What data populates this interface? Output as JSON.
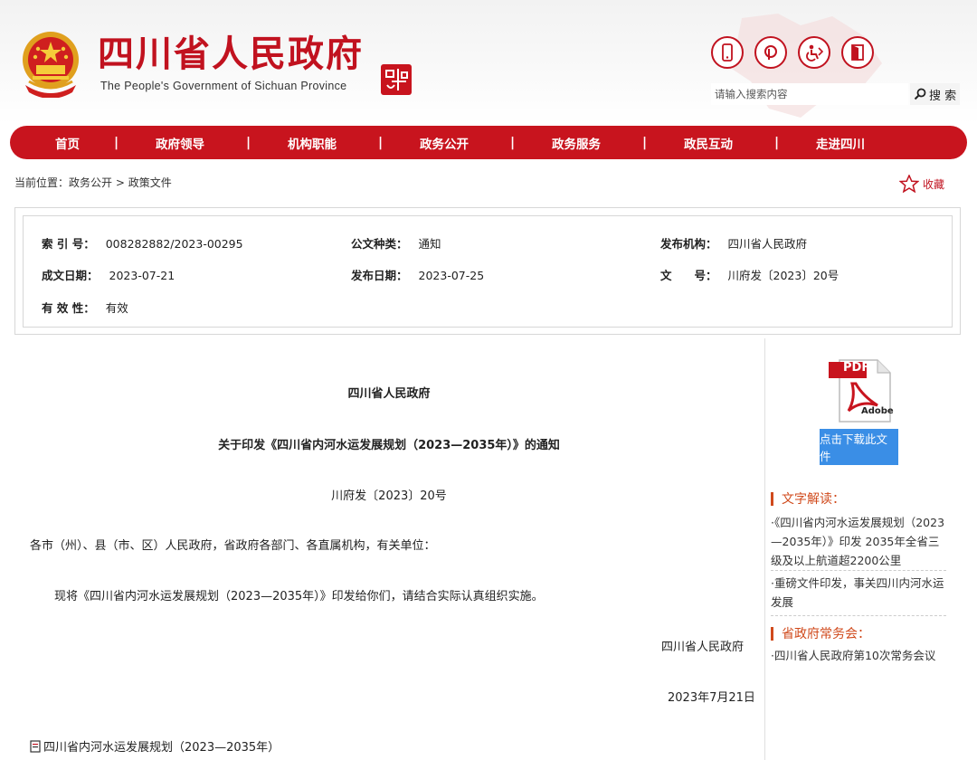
{
  "header": {
    "title": "四川省人民政府",
    "subtitle": "The People's Government of Sichuan Province",
    "search_placeholder": "请输入搜索内容",
    "search_label": "搜 索",
    "icons": [
      "mobile-icon",
      "weibo-icon",
      "accessibility-icon",
      "exit-icon"
    ],
    "accent_color": "#c8141e"
  },
  "nav": {
    "items": [
      "首页",
      "政府领导",
      "机构职能",
      "政务公开",
      "政务服务",
      "政民互动",
      "走进四川"
    ],
    "separator": "|"
  },
  "breadcrumb": {
    "prefix": "当前位置：",
    "items": [
      "政务公开",
      "政策文件"
    ],
    "separator": " > "
  },
  "favorite_label": "收藏",
  "meta": {
    "index_label": "索 引 号：",
    "index_value": "008282882/2023-00295",
    "type_label": "公文种类：",
    "type_value": "通知",
    "org_label": "发布机构：",
    "org_value": "四川省人民政府",
    "written_label": "成文日期：",
    "written_value": "2023-07-21",
    "published_label": "发布日期：",
    "published_value": "2023-07-25",
    "docno_label": "文　　号：",
    "docno_value": "川府发〔2023〕20号",
    "validity_label": "有 效 性：",
    "validity_value": "有效"
  },
  "document": {
    "issuer": "四川省人民政府",
    "title": "关于印发《四川省内河水运发展规划（2023—2035年）》的通知",
    "doc_number": "川府发〔2023〕20号",
    "addressee": "各市（州）、县（市、区）人民政府，省政府各部门、各直属机构，有关单位：",
    "body": "现将《四川省内河水运发展规划（2023—2035年）》印发给你们，请结合实际认真组织实施。",
    "signature": "四川省人民政府",
    "date": "2023年7月21日",
    "attachment": "四川省内河水运发展规划（2023—2035年）"
  },
  "sidebar": {
    "pdf_label": "PDF",
    "pdf_brand": "Adobe",
    "download_label": "点击下载此文件",
    "interpret_title": "文字解读：",
    "interpret_links": [
      "·《四川省内河水运发展规划（2023—2035年）》印发 2035年全省三级及以上航道超2200公里",
      "·重磅文件印发，事关四川内河水运发展"
    ],
    "meeting_title": "省政府常务会：",
    "meeting_links": [
      "·四川省人民政府第10次常务会议"
    ],
    "accent_color": "#d04a1c",
    "button_color": "#3a8ee6"
  }
}
